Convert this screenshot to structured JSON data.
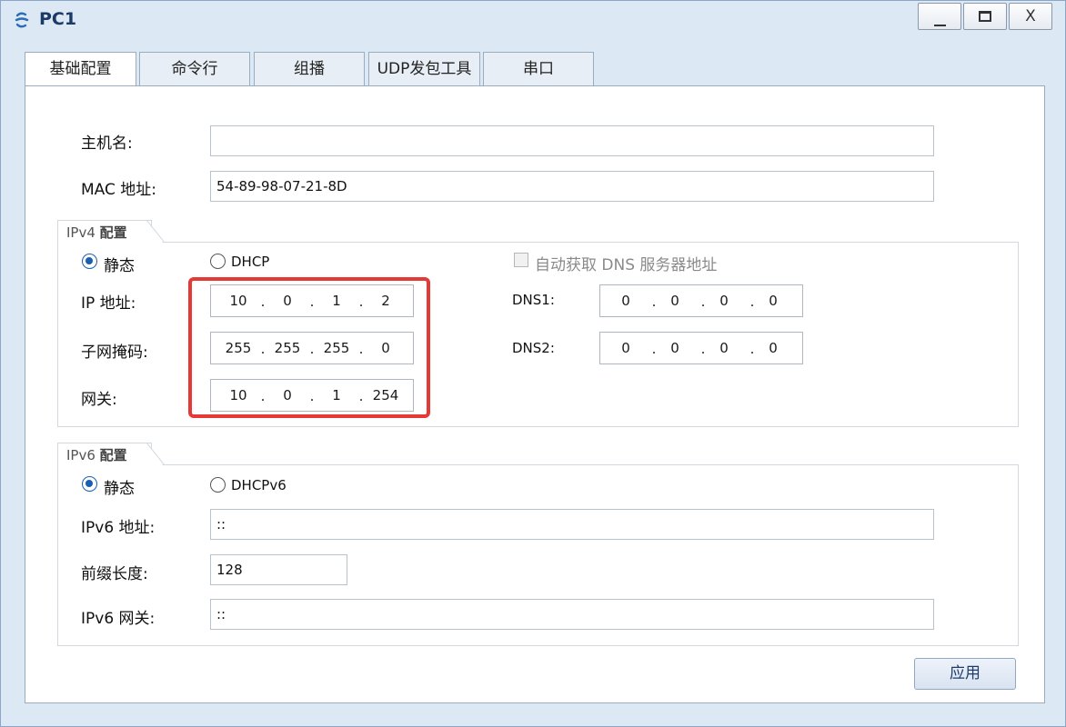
{
  "window": {
    "title": "PC1",
    "controls": {
      "minimize": "",
      "maximize": "",
      "close": "X"
    }
  },
  "tabs": [
    {
      "label": "基础配置",
      "active": true
    },
    {
      "label": "命令行",
      "active": false
    },
    {
      "label": "组播",
      "active": false
    },
    {
      "label": "UDP发包工具",
      "active": false
    },
    {
      "label": "串口",
      "active": false
    }
  ],
  "basic": {
    "hostname_label": "主机名:",
    "hostname_value": "",
    "mac_label": "MAC 地址:",
    "mac_value": "54-89-98-07-21-8D"
  },
  "ipv4": {
    "group_title_prefix": "IPv4",
    "group_title_suffix": "配置",
    "static_label": "静态",
    "static_selected": true,
    "dhcp_label": "DHCP",
    "dhcp_selected": false,
    "dns_auto_label": "自动获取 DNS 服务器地址",
    "dns_auto_checked": false,
    "ip_label": "IP 地址:",
    "ip": [
      "10",
      "0",
      "1",
      "2"
    ],
    "mask_label": "子网掩码:",
    "mask": [
      "255",
      "255",
      "255",
      "0"
    ],
    "gateway_label": "网关:",
    "gateway": [
      "10",
      "0",
      "1",
      "254"
    ],
    "dns1_label": "DNS1:",
    "dns1": [
      "0",
      "0",
      "0",
      "0"
    ],
    "dns2_label": "DNS2:",
    "dns2": [
      "0",
      "0",
      "0",
      "0"
    ]
  },
  "ipv6": {
    "group_title_prefix": "IPv6",
    "group_title_suffix": "配置",
    "static_label": "静态",
    "static_selected": true,
    "dhcp_label": "DHCPv6",
    "dhcp_selected": false,
    "address_label": "IPv6 地址:",
    "address_value": "::",
    "prefix_label": "前缀长度:",
    "prefix_value": "128",
    "gateway_label": "IPv6 网关:",
    "gateway_value": "::"
  },
  "apply_label": "应用",
  "colors": {
    "highlight": "#e53935",
    "radio_selected": "#1a5fb0",
    "window_bg": "#dde8f5"
  }
}
